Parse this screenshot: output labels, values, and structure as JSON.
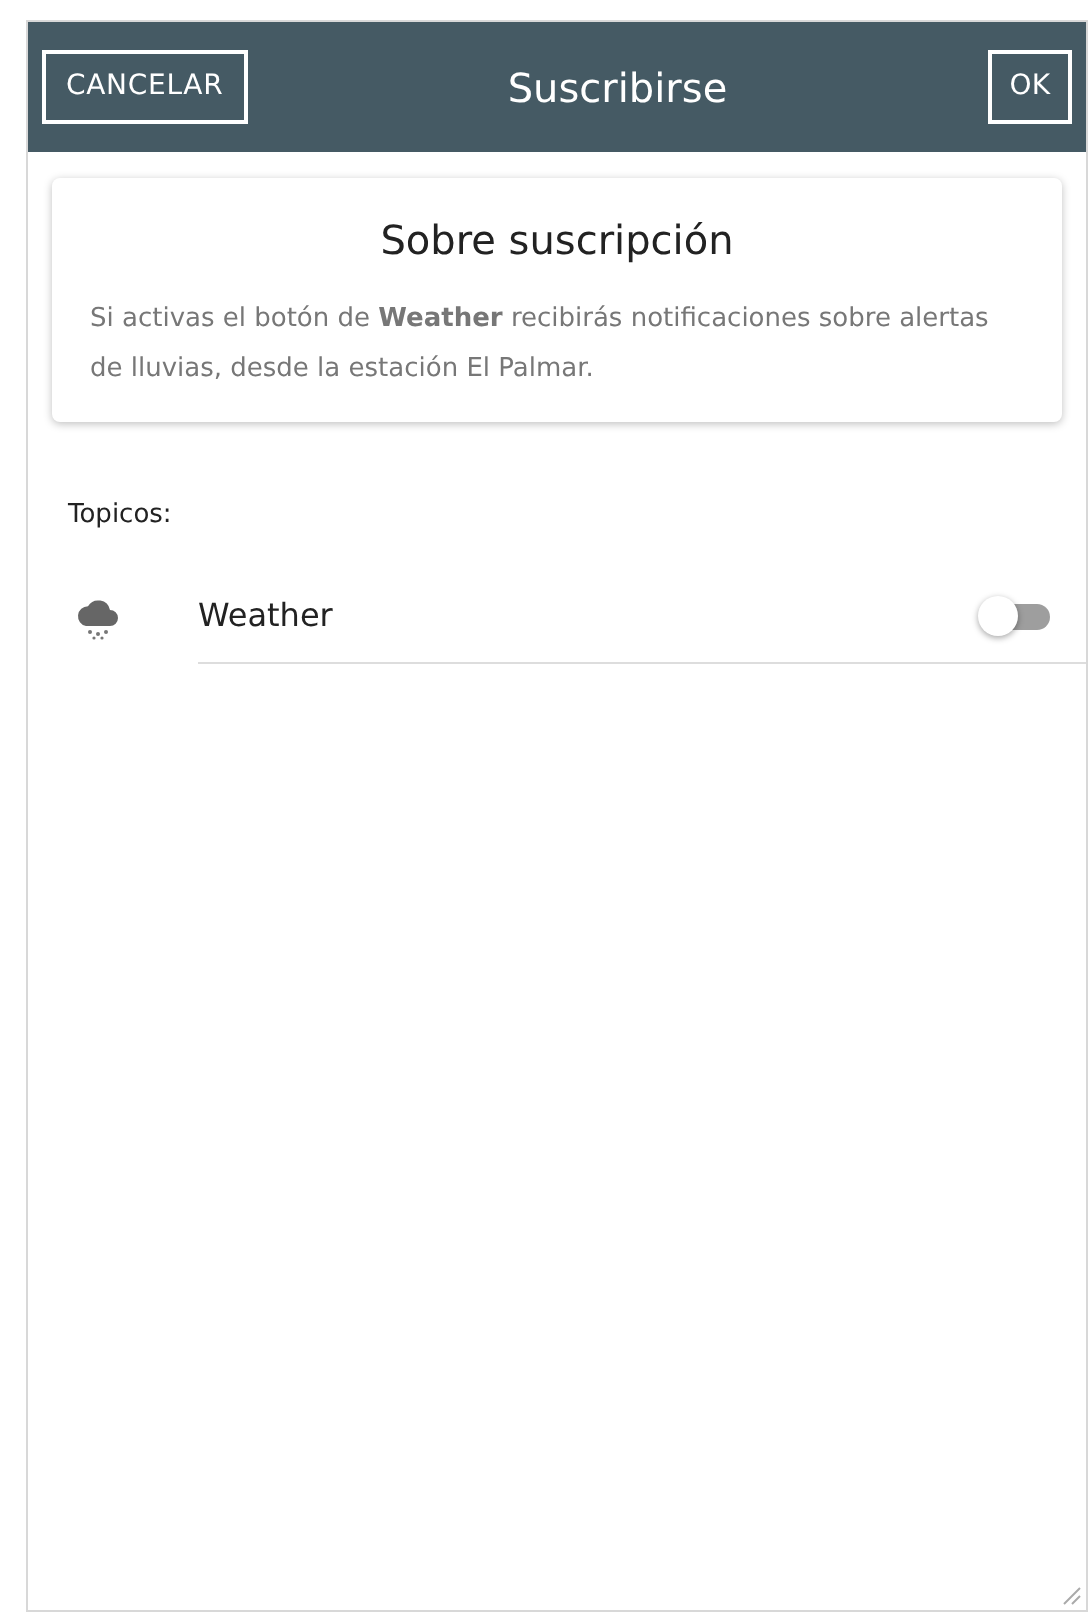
{
  "header": {
    "cancel": "CANCELAR",
    "title": "Suscribirse",
    "ok": "OK"
  },
  "info_card": {
    "title": "Sobre suscripción",
    "body": "Si activas el botón de **Weather** recibirás notificaciones sobre alertas de lluvias, desde la estación El Palmar."
  },
  "topics_label": "Topicos:",
  "topics": [
    {
      "label": "Weather",
      "on": false
    }
  ]
}
